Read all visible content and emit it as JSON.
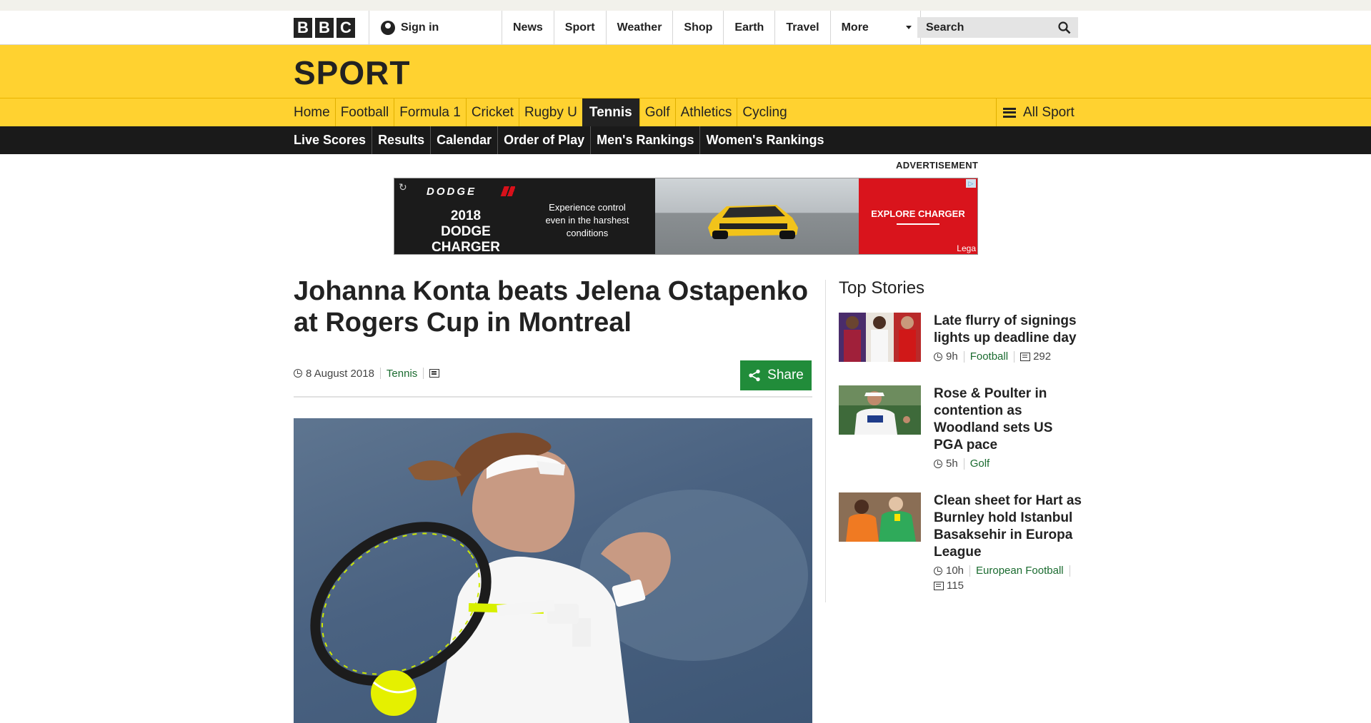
{
  "global_nav": {
    "logo_letters": [
      "B",
      "B",
      "C"
    ],
    "sign_in": "Sign in",
    "items": [
      "News",
      "Sport",
      "Weather",
      "Shop",
      "Earth",
      "Travel"
    ],
    "more": "More",
    "search_placeholder": "Search"
  },
  "sport": {
    "title": "SPORT",
    "nav": [
      {
        "label": "Home",
        "active": false
      },
      {
        "label": "Football",
        "active": false
      },
      {
        "label": "Formula 1",
        "active": false
      },
      {
        "label": "Cricket",
        "active": false
      },
      {
        "label": "Rugby U",
        "active": false
      },
      {
        "label": "Tennis",
        "active": true
      },
      {
        "label": "Golf",
        "active": false
      },
      {
        "label": "Athletics",
        "active": false
      },
      {
        "label": "Cycling",
        "active": false
      }
    ],
    "all_sport": "All Sport",
    "accent": "#ffd230"
  },
  "sub_nav": [
    "Live Scores",
    "Results",
    "Calendar",
    "Order of Play",
    "Men's Rankings",
    "Women's Rankings"
  ],
  "ad": {
    "label": "ADVERTISEMENT",
    "brand": "DODGE",
    "model": "2018 DODGE CHARGER",
    "copy": "Experience control even in the harshest conditions",
    "cta": "EXPLORE CHARGER",
    "legal": "Lega"
  },
  "article": {
    "headline": "Johanna Konta beats Jelena Ostapenko at Rogers Cup in Montreal",
    "date": "8 August 2018",
    "section": "Tennis",
    "share": "Share",
    "share_color": "#218c3a"
  },
  "top_stories": {
    "title": "Top Stories",
    "items": [
      {
        "title": "Late flurry of signings lights up deadline day",
        "time": "9h",
        "section": "Football",
        "comments": "292"
      },
      {
        "title": "Rose & Poulter in contention as Woodland sets US PGA pace",
        "time": "5h",
        "section": "Golf",
        "comments": ""
      },
      {
        "title": "Clean sheet for Hart as Burnley hold Istanbul Basaksehir in Europa League",
        "time": "10h",
        "section": "European Football",
        "comments": "115"
      }
    ]
  }
}
